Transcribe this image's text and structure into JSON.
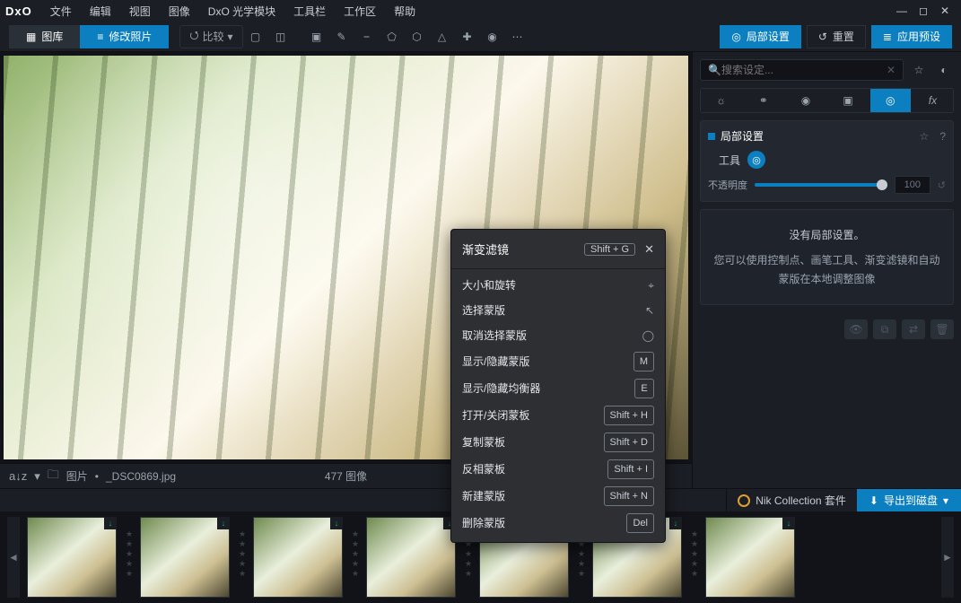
{
  "app": {
    "logo": "DxO"
  },
  "menu": [
    "文件",
    "编辑",
    "视图",
    "图像",
    "DxO 光学模块",
    "工具栏",
    "工作区",
    "帮助"
  ],
  "tabs": {
    "library": "图库",
    "develop": "修改照片"
  },
  "compare_label": "比较",
  "right_buttons": {
    "local": "局部设置",
    "reset": "重置",
    "preset": "应用预设"
  },
  "search": {
    "placeholder": "搜索设定..."
  },
  "panel": {
    "title": "局部设置",
    "tool_label": "工具",
    "opacity_label": "不透明度",
    "opacity_value": "100",
    "empty_title": "没有局部设置。",
    "empty_desc": "您可以使用控制点、画笔工具、渐变滤镜和自动蒙版在本地调整图像"
  },
  "status": {
    "sort_icon": "a↓z",
    "folder_label": "图片",
    "filename": "_DSC0869.jpg",
    "count": "477 图像"
  },
  "nik_label": "Nik Collection 套件",
  "export_label": "导出到磁盘",
  "context": {
    "title": "渐变滤镜",
    "title_key": "Shift + G",
    "items": [
      {
        "label": "大小和旋转",
        "icon": "target"
      },
      {
        "label": "选择蒙版",
        "icon": "cursor"
      },
      {
        "label": "取消选择蒙版",
        "icon": "ring"
      },
      {
        "label": "显示/隐藏蒙版",
        "key": "M"
      },
      {
        "label": "显示/隐藏均衡器",
        "key": "E"
      },
      {
        "label": "打开/关闭蒙板",
        "key": "Shift + H"
      },
      {
        "label": "复制蒙板",
        "key": "Shift + D"
      },
      {
        "label": "反相蒙板",
        "key": "Shift + I"
      },
      {
        "label": "新建蒙版",
        "key": "Shift + N"
      },
      {
        "label": "删除蒙版",
        "key": "Del"
      }
    ]
  },
  "thumb_count": 7
}
